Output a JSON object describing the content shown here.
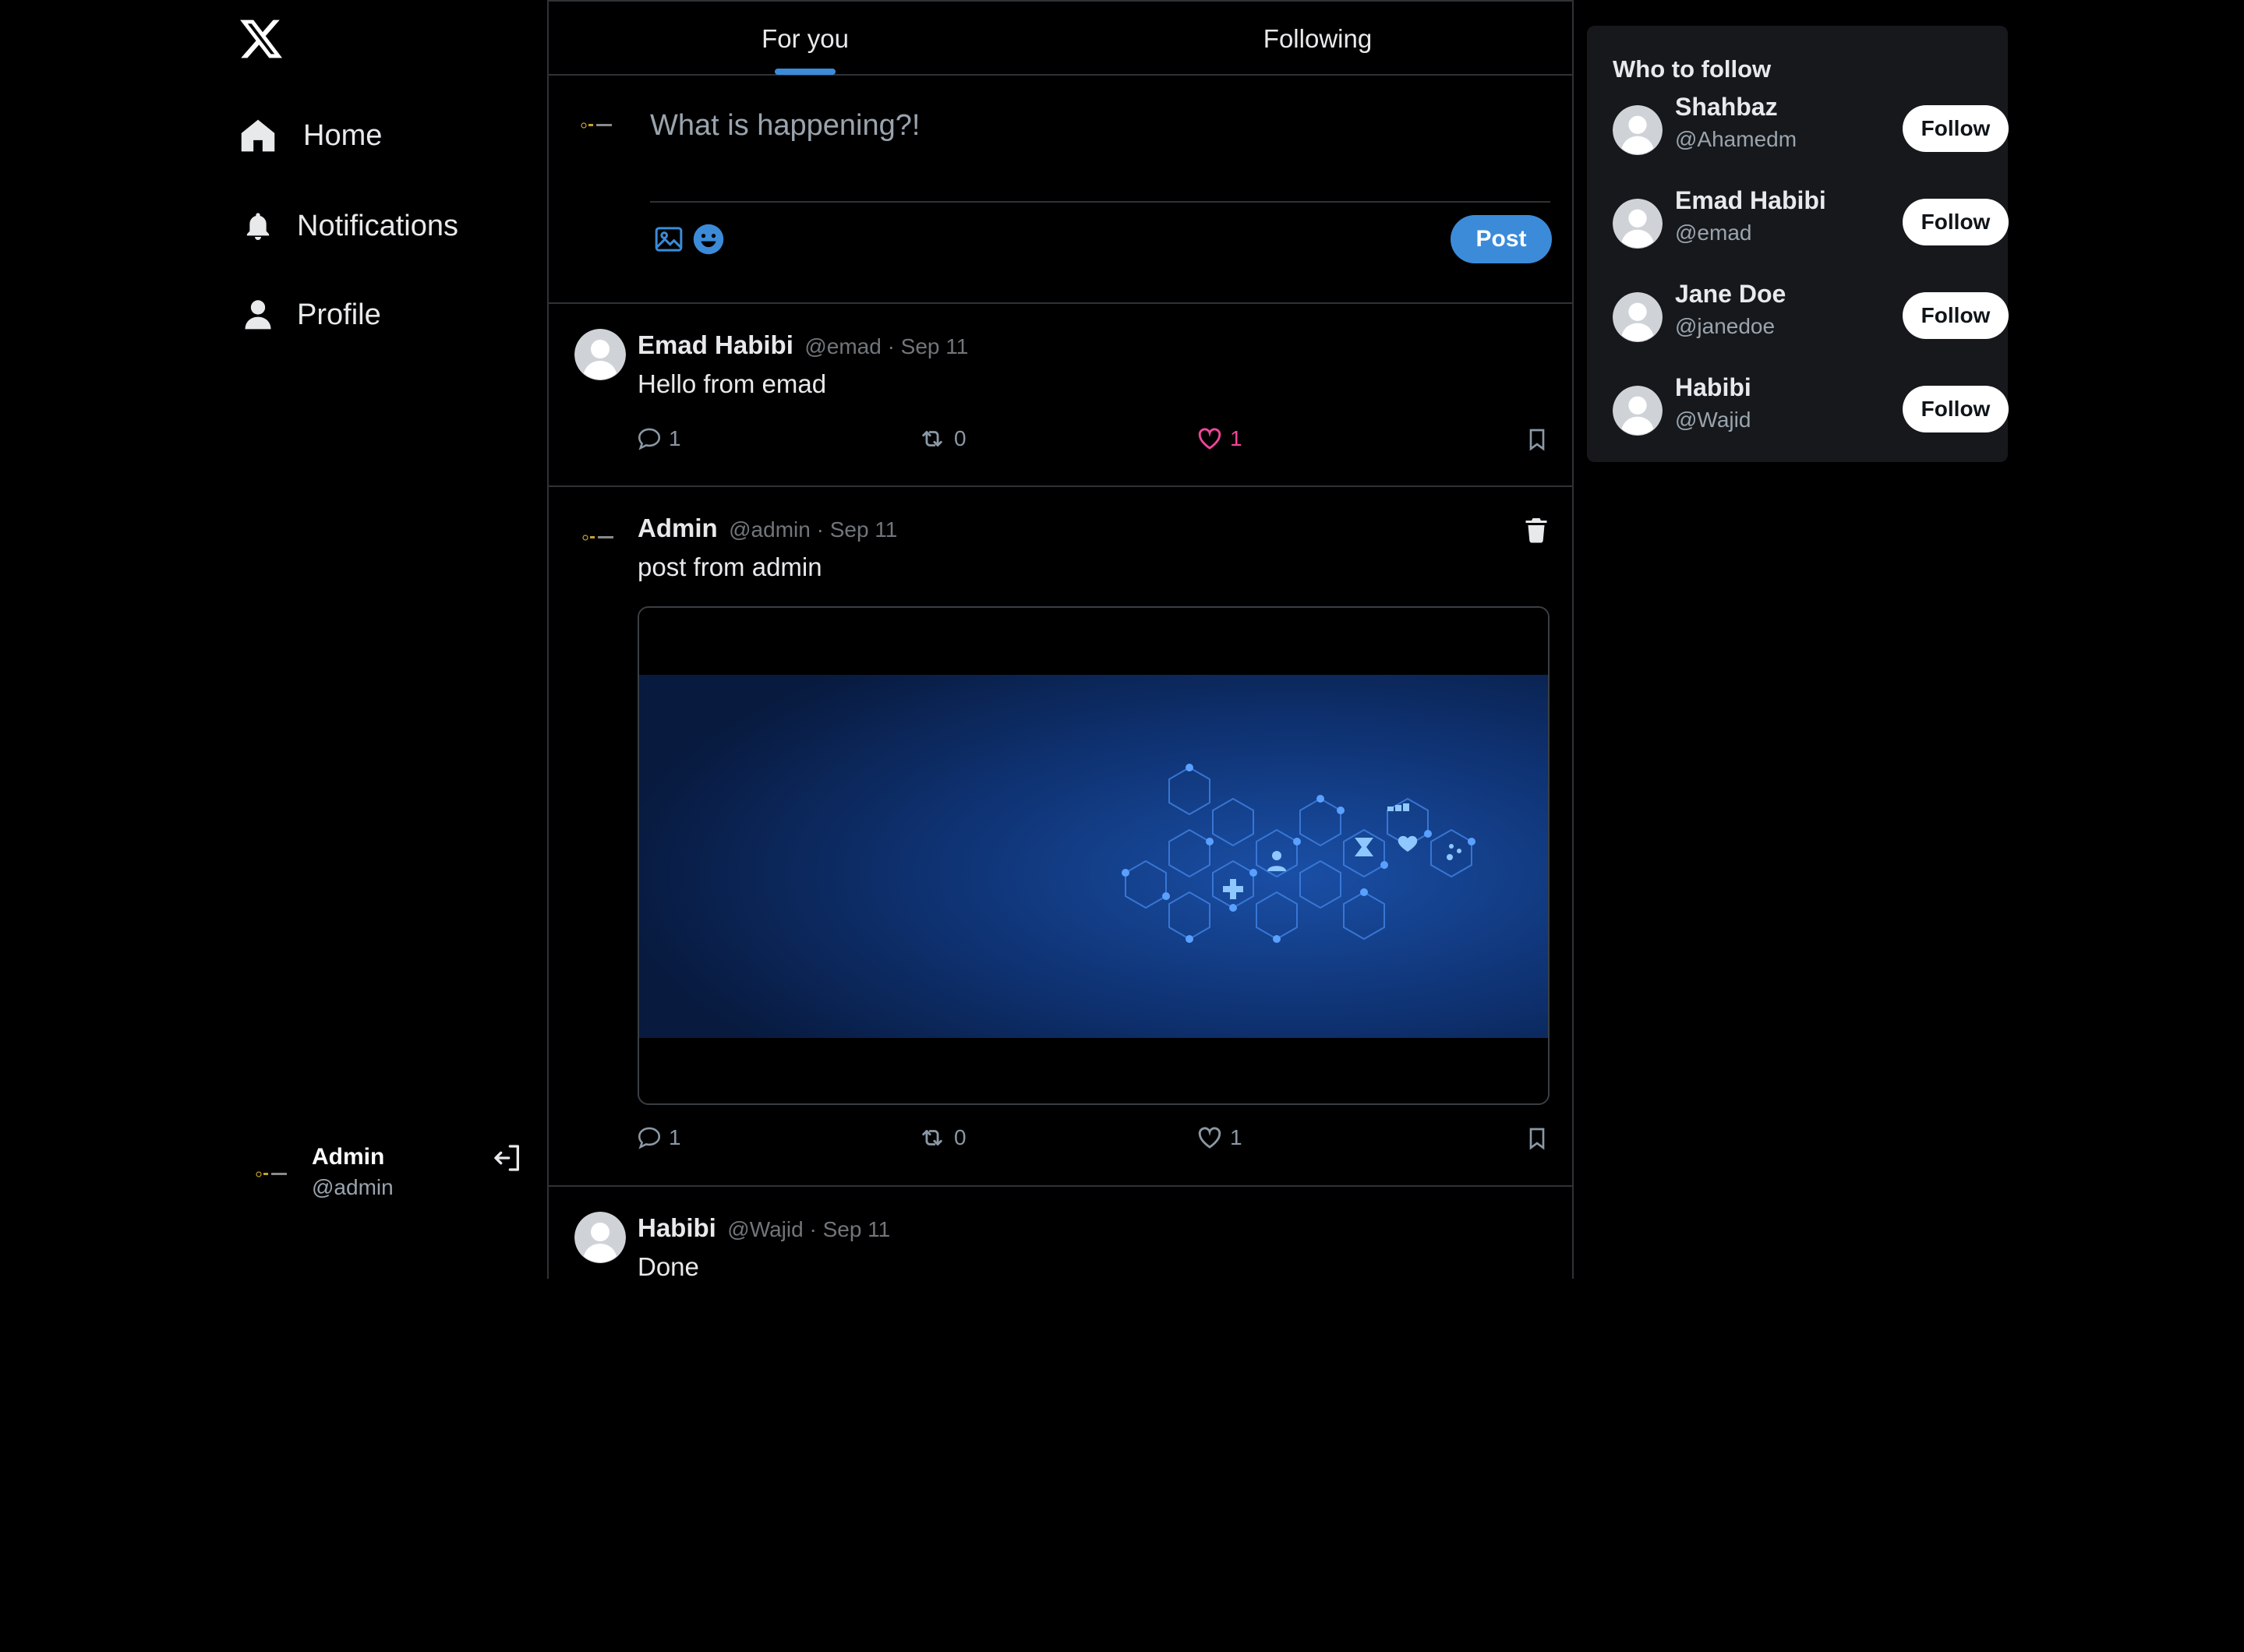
{
  "nav": {
    "items": [
      {
        "label": "Home",
        "icon": "home-icon"
      },
      {
        "label": "Notifications",
        "icon": "bell-icon"
      },
      {
        "label": "Profile",
        "icon": "person-icon"
      }
    ]
  },
  "account": {
    "name": "Admin",
    "handle": "@admin"
  },
  "tabs": [
    {
      "label": "For you",
      "active": true
    },
    {
      "label": "Following",
      "active": false
    }
  ],
  "composer": {
    "placeholder": "What is happening?!",
    "post_label": "Post"
  },
  "posts": [
    {
      "name": "Emad Habibi",
      "meta": "@emad · Sep 11",
      "text": "Hello from emad",
      "replies": "1",
      "retweets": "0",
      "likes": "1",
      "liked": true
    },
    {
      "name": "Admin",
      "meta": "@admin · Sep 11",
      "text": "post from admin",
      "replies": "1",
      "retweets": "0",
      "likes": "1",
      "liked": false,
      "has_image": true,
      "deletable": true
    },
    {
      "name": "Habibi",
      "meta": "@Wajid · Sep 11",
      "text": "Done"
    }
  ],
  "who_to_follow": {
    "title": "Who to follow",
    "users": [
      {
        "name": "Shahbaz",
        "handle": "@Ahamedm",
        "button": "Follow"
      },
      {
        "name": "Emad Habibi",
        "handle": "@emad",
        "button": "Follow"
      },
      {
        "name": "Jane Doe",
        "handle": "@janedoe",
        "button": "Follow"
      },
      {
        "name": "Habibi",
        "handle": "@Wajid",
        "button": "Follow"
      }
    ]
  },
  "colors": {
    "accent": "#3b8bd9",
    "like": "#f0479a",
    "background": "#000000",
    "border": "#2f3336"
  }
}
